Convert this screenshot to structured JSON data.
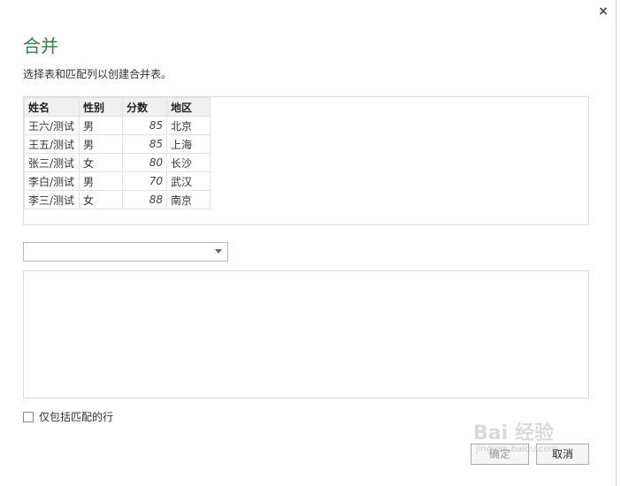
{
  "dialog": {
    "title": "合并",
    "subtitle": "选择表和匹配列以创建合并表。",
    "close_label": "×"
  },
  "preview_table": {
    "headers": [
      "姓名",
      "性别",
      "分数",
      "地区"
    ],
    "rows": [
      [
        "王六/测试",
        "男",
        "85",
        "北京"
      ],
      [
        "王五/测试",
        "男",
        "85",
        "上海"
      ],
      [
        "张三/测试",
        "女",
        "80",
        "长沙"
      ],
      [
        "李白/测试",
        "男",
        "70",
        "武汉"
      ],
      [
        "李三/测试",
        "女",
        "88",
        "南京"
      ]
    ]
  },
  "second_table_select": {
    "selected_value": ""
  },
  "options": {
    "only_matching_rows_label": "仅包括匹配的行"
  },
  "buttons": {
    "ok_label": "确定",
    "cancel_label": "取消"
  },
  "watermark": {
    "text": "Bai 经验",
    "sub": "jingyan.baidu.com"
  },
  "colors": {
    "title_green": "#2f7d4a",
    "header_bg": "#f0f0f0"
  }
}
